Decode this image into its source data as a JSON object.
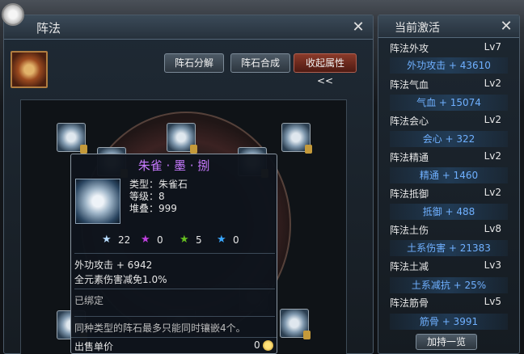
{
  "main_panel": {
    "title": "阵法",
    "buttons": {
      "decompose": "阵石分解",
      "synthesize": "阵石合成",
      "collapse": "收起属性<<"
    }
  },
  "tooltip": {
    "name": "朱雀 · 墨 · 捌",
    "type": "类型：朱雀石",
    "level": "等级：8",
    "stack": "堆叠：999",
    "gems": [
      {
        "icon": "blue-star-icon",
        "count": "22"
      },
      {
        "icon": "purple-star-icon",
        "count": "0"
      },
      {
        "icon": "green-star-icon",
        "count": "5"
      },
      {
        "icon": "cyan-star-icon",
        "count": "0"
      }
    ],
    "stat1": "外功攻击 + 6942",
    "stat2": "全元素伤害减免1.0%",
    "bound": "已绑定",
    "note": "同种类型的阵石最多只能同时镶嵌4个。",
    "sell_label": "出售单价",
    "sell_price": "0"
  },
  "side_panel": {
    "title": "当前激活",
    "stats": [
      {
        "name": "阵法外攻",
        "lv": "Lv7",
        "bonus": "外功攻击 + 43610"
      },
      {
        "name": "阵法气血",
        "lv": "Lv2",
        "bonus": "气血 + 15074"
      },
      {
        "name": "阵法会心",
        "lv": "Lv2",
        "bonus": "会心 + 322"
      },
      {
        "name": "阵法精通",
        "lv": "Lv2",
        "bonus": "精通 + 1460"
      },
      {
        "name": "阵法抵御",
        "lv": "Lv2",
        "bonus": "抵御 + 488"
      },
      {
        "name": "阵法土伤",
        "lv": "Lv8",
        "bonus": "土系伤害 + 21383"
      },
      {
        "name": "阵法土减",
        "lv": "Lv3",
        "bonus": "土系减抗 + 25%"
      },
      {
        "name": "阵法筋骨",
        "lv": "Lv5",
        "bonus": "筋骨 + 3991"
      }
    ],
    "list_button": "加持一览"
  },
  "colors": {
    "item_name": "#c77aff",
    "bonus_text": "#6fb0ff"
  }
}
